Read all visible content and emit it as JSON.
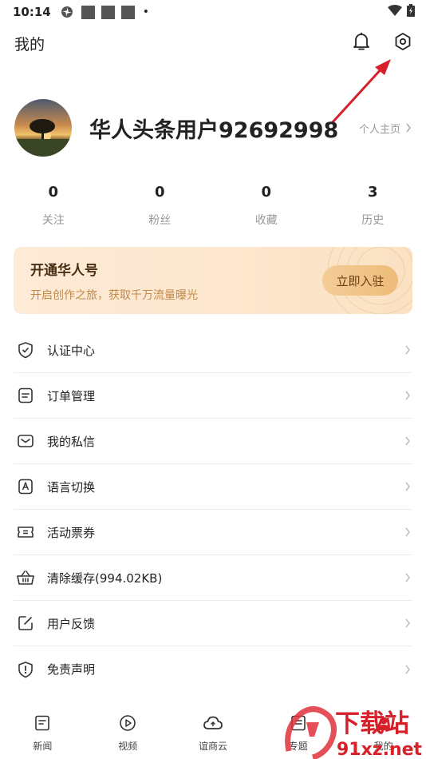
{
  "status_bar": {
    "time": "10:14"
  },
  "header": {
    "title": "我的"
  },
  "profile": {
    "username": "华人头条用户92692998",
    "homepage_label": "个人主页"
  },
  "stats": [
    {
      "value": "0",
      "label": "关注"
    },
    {
      "value": "0",
      "label": "粉丝"
    },
    {
      "value": "0",
      "label": "收藏"
    },
    {
      "value": "3",
      "label": "历史"
    }
  ],
  "promo": {
    "title": "开通华人号",
    "subtitle": "开启创作之旅，获取千万流量曝光",
    "button": "立即入驻"
  },
  "menu": [
    {
      "label": "认证中心",
      "icon": "shield-check-icon"
    },
    {
      "label": "订单管理",
      "icon": "order-icon"
    },
    {
      "label": "我的私信",
      "icon": "mail-icon"
    },
    {
      "label": "语言切换",
      "icon": "language-icon"
    },
    {
      "label": "活动票券",
      "icon": "ticket-icon"
    },
    {
      "label": "清除缓存(994.02KB)",
      "icon": "basket-icon"
    },
    {
      "label": "用户反馈",
      "icon": "feedback-icon"
    },
    {
      "label": "免责声明",
      "icon": "shield-alert-icon"
    }
  ],
  "tabs": [
    {
      "label": "新闻",
      "icon": "news-icon"
    },
    {
      "label": "视频",
      "icon": "play-icon"
    },
    {
      "label": "谊商云",
      "icon": "cloud-icon"
    },
    {
      "label": "专题",
      "icon": "topic-icon"
    },
    {
      "label": "我的",
      "icon": "me-icon"
    }
  ],
  "watermark": {
    "text1": "下载站",
    "text2": "91xz.net"
  },
  "colors": {
    "accent_arrow": "#d6202a",
    "promo_bg": "#fbe4c9",
    "promo_button": "#f0c382"
  }
}
